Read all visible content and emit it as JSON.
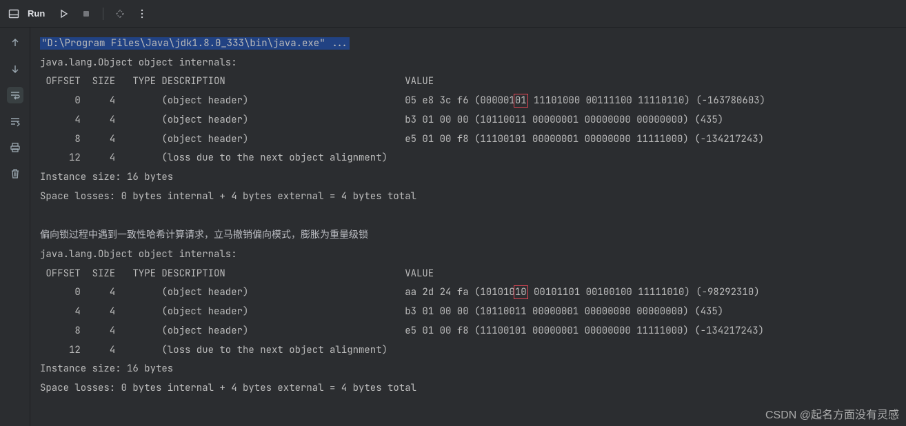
{
  "toolbar": {
    "run_label": "Run"
  },
  "console": {
    "cmd_line": "\"D:\\Program Files\\Java\\jdk1.8.0_333\\bin\\java.exe\" ...",
    "block1": {
      "title": "java.lang.Object object internals:",
      "header": " OFFSET  SIZE   TYPE DESCRIPTION                               VALUE",
      "rows": [
        {
          "lead": "      0     4        (object header)                           05 e8 3c f6 (000001",
          "hl": "01",
          "tail": " 11101000 00111100 11110110) (-163780603)"
        },
        {
          "lead": "      4     4        (object header)                           b3 01 00 00 (10110011 00000001 00000000 00000000) (435)",
          "hl": "",
          "tail": ""
        },
        {
          "lead": "      8     4        (object header)                           e5 01 00 f8 (11100101 00000001 00000000 11111000) (-134217243)",
          "hl": "",
          "tail": ""
        },
        {
          "lead": "     12     4        (loss due to the next object alignment)",
          "hl": "",
          "tail": ""
        }
      ],
      "size": "Instance size: 16 bytes",
      "losses": "Space losses: 0 bytes internal + 4 bytes external = 4 bytes total"
    },
    "note_cn": "偏向锁过程中遇到一致性哈希计算请求，立马撤销偏向模式，膨胀为重量级锁",
    "block2": {
      "title": "java.lang.Object object internals:",
      "header": " OFFSET  SIZE   TYPE DESCRIPTION                               VALUE",
      "rows": [
        {
          "lead": "      0     4        (object header)                           aa 2d 24 fa (101010",
          "hl": "10",
          "tail": " 00101101 00100100 11111010) (-98292310)"
        },
        {
          "lead": "      4     4        (object header)                           b3 01 00 00 (10110011 00000001 00000000 00000000) (435)",
          "hl": "",
          "tail": ""
        },
        {
          "lead": "      8     4        (object header)                           e5 01 00 f8 (11100101 00000001 00000000 11111000) (-134217243)",
          "hl": "",
          "tail": ""
        },
        {
          "lead": "     12     4        (loss due to the next object alignment)",
          "hl": "",
          "tail": ""
        }
      ],
      "size": "Instance size: 16 bytes",
      "losses": "Space losses: 0 bytes internal + 4 bytes external = 4 bytes total"
    }
  },
  "watermark": "CSDN @起名方面没有灵感"
}
